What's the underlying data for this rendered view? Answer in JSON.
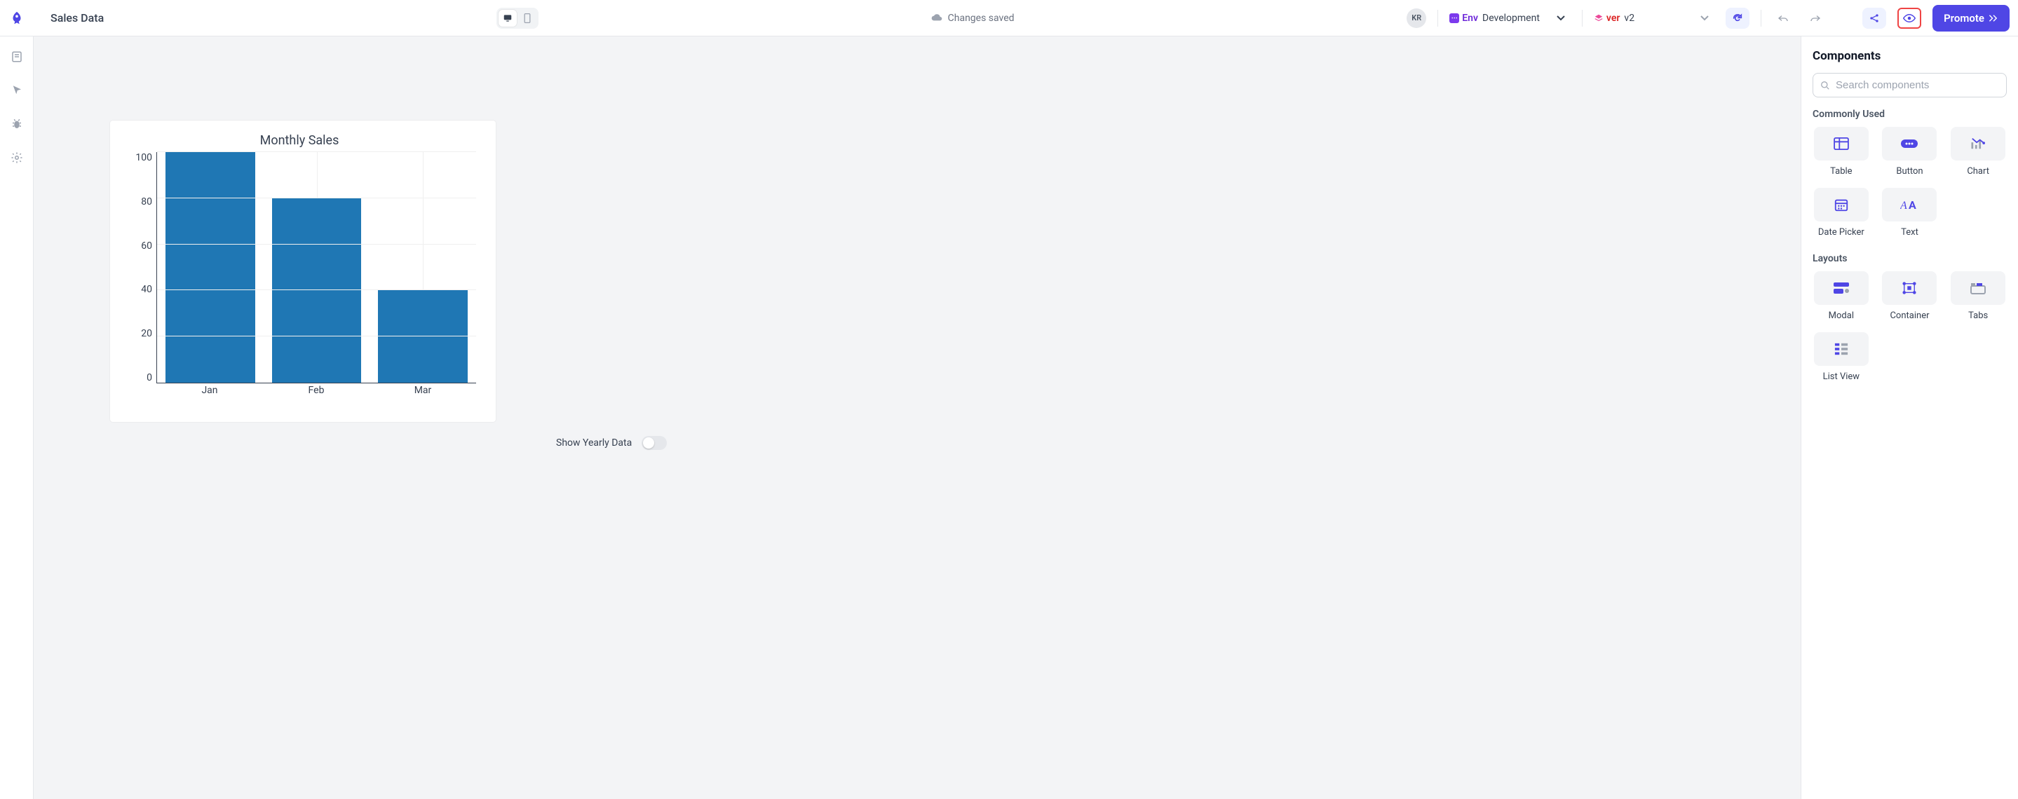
{
  "header": {
    "title": "Sales Data",
    "save_status": "Changes saved",
    "user_initials": "KR",
    "env_tag_short": "Env",
    "env_name": "Development",
    "ver_tag_short": "ver",
    "ver_name": "v2",
    "promote_label": "Promote"
  },
  "canvas": {
    "toggle_label": "Show Yearly Data",
    "toggle_on": false
  },
  "chart_data": {
    "type": "bar",
    "title": "Monthly Sales",
    "categories": [
      "Jan",
      "Feb",
      "Mar"
    ],
    "values": [
      100,
      80,
      40
    ],
    "ylim": [
      0,
      100
    ],
    "yticks": [
      0,
      20,
      40,
      60,
      80,
      100
    ],
    "xlabel": "",
    "ylabel": ""
  },
  "components_panel": {
    "title": "Components",
    "search_placeholder": "Search components",
    "sections": {
      "common_label": "Commonly Used",
      "layouts_label": "Layouts"
    },
    "common": [
      {
        "label": "Table",
        "icon": "table"
      },
      {
        "label": "Button",
        "icon": "button"
      },
      {
        "label": "Chart",
        "icon": "chart"
      },
      {
        "label": "Date Picker",
        "icon": "date"
      },
      {
        "label": "Text",
        "icon": "text"
      }
    ],
    "layouts": [
      {
        "label": "Modal",
        "icon": "modal"
      },
      {
        "label": "Container",
        "icon": "container"
      },
      {
        "label": "Tabs",
        "icon": "tabs"
      },
      {
        "label": "List View",
        "icon": "list"
      }
    ]
  }
}
